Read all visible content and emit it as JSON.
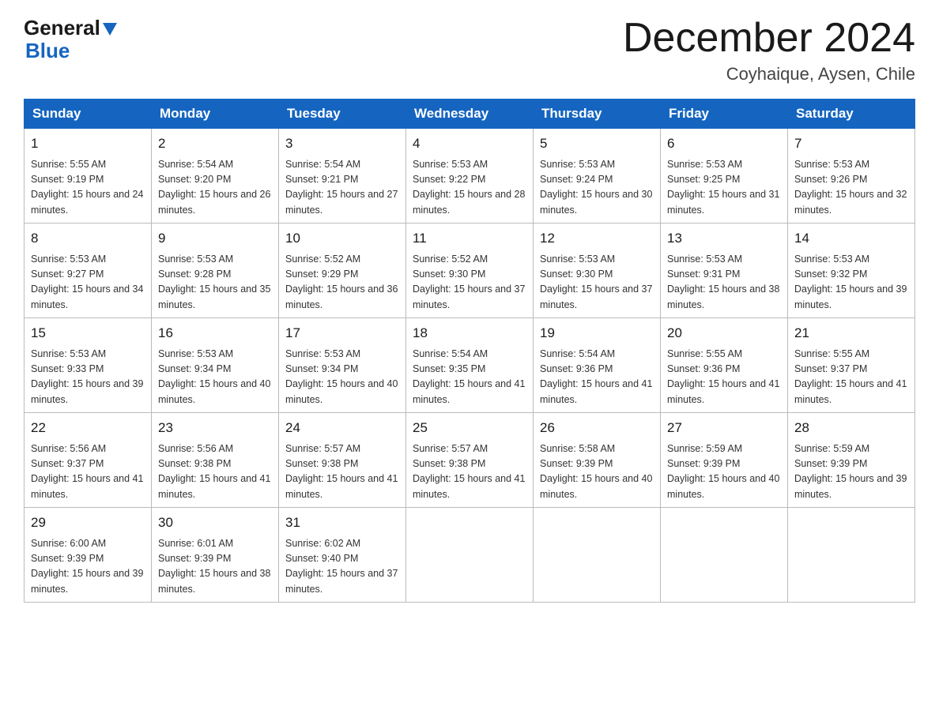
{
  "header": {
    "logo_general": "General",
    "logo_blue": "Blue",
    "month_title": "December 2024",
    "subtitle": "Coyhaique, Aysen, Chile"
  },
  "calendar": {
    "days_of_week": [
      "Sunday",
      "Monday",
      "Tuesday",
      "Wednesday",
      "Thursday",
      "Friday",
      "Saturday"
    ],
    "weeks": [
      [
        {
          "day": "1",
          "sunrise": "5:55 AM",
          "sunset": "9:19 PM",
          "daylight": "15 hours and 24 minutes."
        },
        {
          "day": "2",
          "sunrise": "5:54 AM",
          "sunset": "9:20 PM",
          "daylight": "15 hours and 26 minutes."
        },
        {
          "day": "3",
          "sunrise": "5:54 AM",
          "sunset": "9:21 PM",
          "daylight": "15 hours and 27 minutes."
        },
        {
          "day": "4",
          "sunrise": "5:53 AM",
          "sunset": "9:22 PM",
          "daylight": "15 hours and 28 minutes."
        },
        {
          "day": "5",
          "sunrise": "5:53 AM",
          "sunset": "9:24 PM",
          "daylight": "15 hours and 30 minutes."
        },
        {
          "day": "6",
          "sunrise": "5:53 AM",
          "sunset": "9:25 PM",
          "daylight": "15 hours and 31 minutes."
        },
        {
          "day": "7",
          "sunrise": "5:53 AM",
          "sunset": "9:26 PM",
          "daylight": "15 hours and 32 minutes."
        }
      ],
      [
        {
          "day": "8",
          "sunrise": "5:53 AM",
          "sunset": "9:27 PM",
          "daylight": "15 hours and 34 minutes."
        },
        {
          "day": "9",
          "sunrise": "5:53 AM",
          "sunset": "9:28 PM",
          "daylight": "15 hours and 35 minutes."
        },
        {
          "day": "10",
          "sunrise": "5:52 AM",
          "sunset": "9:29 PM",
          "daylight": "15 hours and 36 minutes."
        },
        {
          "day": "11",
          "sunrise": "5:52 AM",
          "sunset": "9:30 PM",
          "daylight": "15 hours and 37 minutes."
        },
        {
          "day": "12",
          "sunrise": "5:53 AM",
          "sunset": "9:30 PM",
          "daylight": "15 hours and 37 minutes."
        },
        {
          "day": "13",
          "sunrise": "5:53 AM",
          "sunset": "9:31 PM",
          "daylight": "15 hours and 38 minutes."
        },
        {
          "day": "14",
          "sunrise": "5:53 AM",
          "sunset": "9:32 PM",
          "daylight": "15 hours and 39 minutes."
        }
      ],
      [
        {
          "day": "15",
          "sunrise": "5:53 AM",
          "sunset": "9:33 PM",
          "daylight": "15 hours and 39 minutes."
        },
        {
          "day": "16",
          "sunrise": "5:53 AM",
          "sunset": "9:34 PM",
          "daylight": "15 hours and 40 minutes."
        },
        {
          "day": "17",
          "sunrise": "5:53 AM",
          "sunset": "9:34 PM",
          "daylight": "15 hours and 40 minutes."
        },
        {
          "day": "18",
          "sunrise": "5:54 AM",
          "sunset": "9:35 PM",
          "daylight": "15 hours and 41 minutes."
        },
        {
          "day": "19",
          "sunrise": "5:54 AM",
          "sunset": "9:36 PM",
          "daylight": "15 hours and 41 minutes."
        },
        {
          "day": "20",
          "sunrise": "5:55 AM",
          "sunset": "9:36 PM",
          "daylight": "15 hours and 41 minutes."
        },
        {
          "day": "21",
          "sunrise": "5:55 AM",
          "sunset": "9:37 PM",
          "daylight": "15 hours and 41 minutes."
        }
      ],
      [
        {
          "day": "22",
          "sunrise": "5:56 AM",
          "sunset": "9:37 PM",
          "daylight": "15 hours and 41 minutes."
        },
        {
          "day": "23",
          "sunrise": "5:56 AM",
          "sunset": "9:38 PM",
          "daylight": "15 hours and 41 minutes."
        },
        {
          "day": "24",
          "sunrise": "5:57 AM",
          "sunset": "9:38 PM",
          "daylight": "15 hours and 41 minutes."
        },
        {
          "day": "25",
          "sunrise": "5:57 AM",
          "sunset": "9:38 PM",
          "daylight": "15 hours and 41 minutes."
        },
        {
          "day": "26",
          "sunrise": "5:58 AM",
          "sunset": "9:39 PM",
          "daylight": "15 hours and 40 minutes."
        },
        {
          "day": "27",
          "sunrise": "5:59 AM",
          "sunset": "9:39 PM",
          "daylight": "15 hours and 40 minutes."
        },
        {
          "day": "28",
          "sunrise": "5:59 AM",
          "sunset": "9:39 PM",
          "daylight": "15 hours and 39 minutes."
        }
      ],
      [
        {
          "day": "29",
          "sunrise": "6:00 AM",
          "sunset": "9:39 PM",
          "daylight": "15 hours and 39 minutes."
        },
        {
          "day": "30",
          "sunrise": "6:01 AM",
          "sunset": "9:39 PM",
          "daylight": "15 hours and 38 minutes."
        },
        {
          "day": "31",
          "sunrise": "6:02 AM",
          "sunset": "9:40 PM",
          "daylight": "15 hours and 37 minutes."
        },
        null,
        null,
        null,
        null
      ]
    ]
  }
}
